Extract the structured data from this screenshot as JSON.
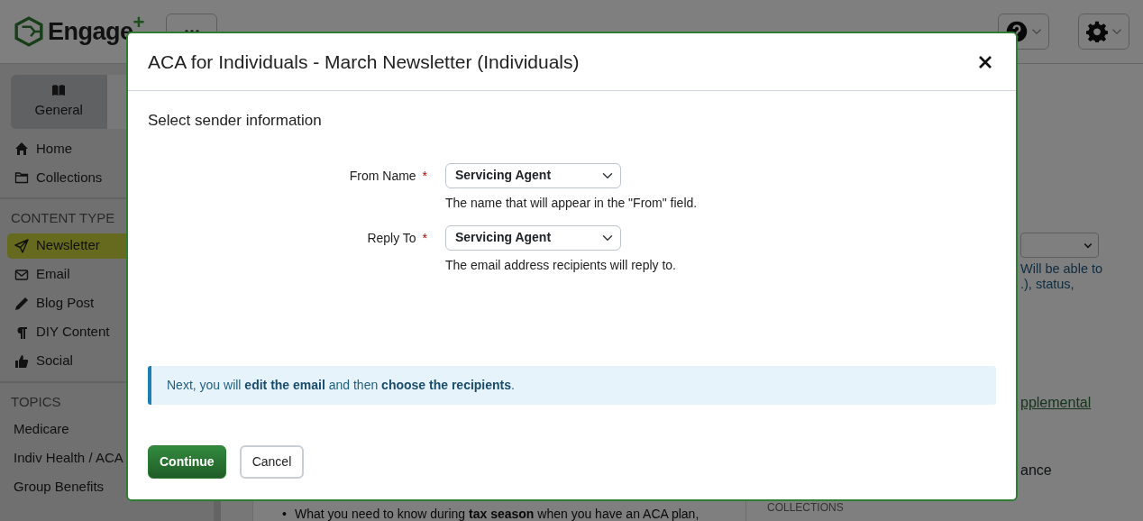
{
  "header": {
    "logo": {
      "text": "Engage",
      "mark": "+"
    }
  },
  "sidebar": {
    "tabs": [
      {
        "label": "General",
        "selected": true
      },
      {
        "selected": false
      }
    ],
    "nav": [
      {
        "label": "Home",
        "kind": "home"
      },
      {
        "label": "Collections",
        "kind": "folder"
      }
    ],
    "sections": [
      {
        "title": "CONTENT TYPE",
        "items": [
          {
            "label": "Newsletter",
            "kind": "send",
            "selected": true
          },
          {
            "label": "Email",
            "kind": "envelope",
            "selected": false
          },
          {
            "label": "Blog Post",
            "kind": "pencil",
            "selected": false
          },
          {
            "label": "DIY Content",
            "kind": "paragraph",
            "selected": false
          },
          {
            "label": "Social",
            "kind": "thumb",
            "selected": false
          }
        ]
      },
      {
        "title": "TOPICS",
        "items": [
          {
            "label": "Medicare",
            "selected": false
          },
          {
            "label": "Indiv Health / ACA",
            "selected": false
          },
          {
            "label": "Group Benefits",
            "selected": false
          }
        ]
      }
    ]
  },
  "main": {
    "bullet_marker": "•",
    "bullet": "What you need to know during **tax season** when you have an ACA plan,",
    "side": {
      "help_lines": [
        "Will be able to",
        ".), status,"
      ],
      "link": "pplemental",
      "text": "ance",
      "heading": "COLLECTIONS"
    }
  },
  "modal": {
    "title": "ACA for Individuals - March Newsletter (Individuals)",
    "subtitle": "Select sender information",
    "fields": [
      {
        "label": "From Name",
        "required_mark": "*",
        "value": "Servicing Agent",
        "help": "The name that will appear in the \"From\" field."
      },
      {
        "label": "Reply To",
        "required_mark": "*",
        "value": "Servicing Agent",
        "help": "The email address recipients will reply to."
      }
    ],
    "info": "Next, you will **edit the email** and then **choose the recipients**.",
    "buttons": [
      {
        "label": "Continue",
        "kind": "primary"
      },
      {
        "label": "Cancel",
        "kind": "secondary"
      }
    ]
  }
}
